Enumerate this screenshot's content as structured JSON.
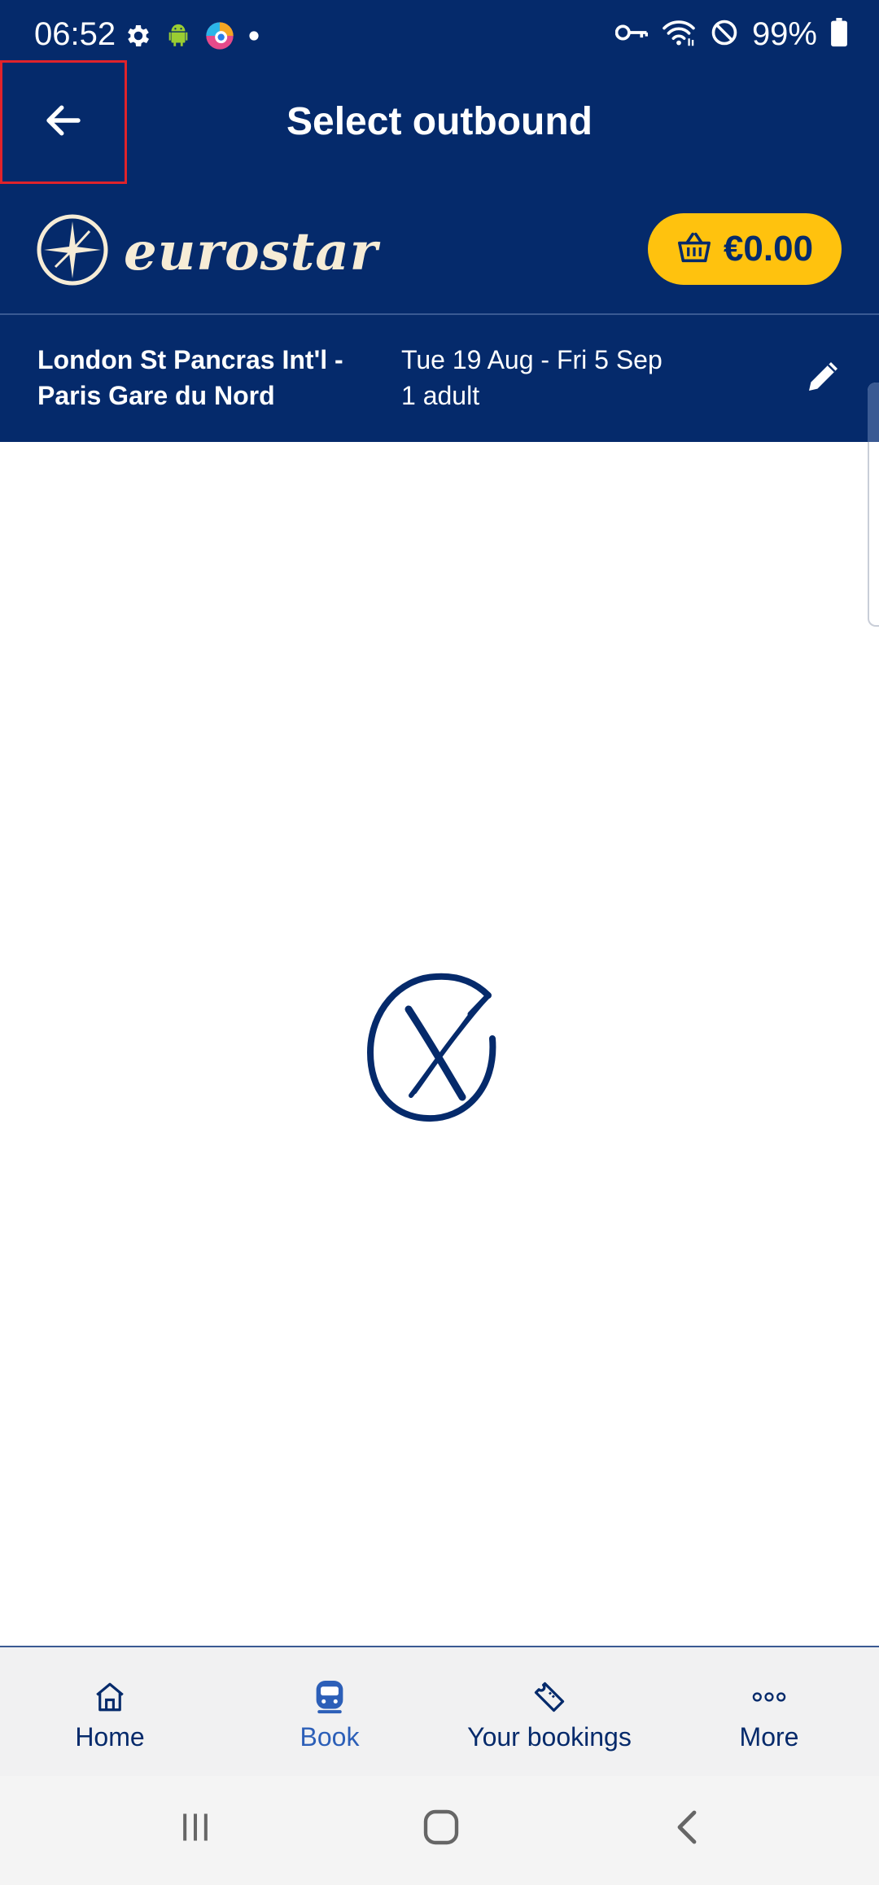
{
  "status_bar": {
    "time": "06:52",
    "battery_percent": "99%",
    "left_icons": [
      "settings-icon",
      "android-icon",
      "browser-icon",
      "dot-icon"
    ],
    "right_icons": [
      "key-icon",
      "wifi-icon",
      "do-not-disturb-icon",
      "battery-icon"
    ]
  },
  "app_bar": {
    "title": "Select outbound",
    "back_icon": "arrow-left-icon"
  },
  "brand": {
    "logo_text": "eurostar",
    "basket_price": "€0.00",
    "basket_icon": "basket-icon"
  },
  "journey": {
    "route_line1": "London St Pancras Int'l -",
    "route_line2": "Paris Gare du Nord",
    "dates": "Tue 19 Aug - Fri 5 Sep",
    "passengers": "1 adult",
    "edit_icon": "pencil-icon"
  },
  "loading": {
    "icon": "eurostar-loading-icon"
  },
  "bottom_nav": {
    "items": [
      {
        "label": "Home",
        "icon": "home-icon",
        "active": false
      },
      {
        "label": "Book",
        "icon": "train-icon",
        "active": true
      },
      {
        "label": "Your bookings",
        "icon": "ticket-icon",
        "active": false
      },
      {
        "label": "More",
        "icon": "more-dots-icon",
        "active": false
      }
    ]
  },
  "system_nav": {
    "items": [
      "recents-icon",
      "home-circle-icon",
      "back-chevron-icon"
    ]
  },
  "colors": {
    "brand_navy": "#052a6b",
    "basket_yellow": "#ffc20e",
    "logo_cream": "#f6ecd6",
    "active_nav": "#2c5fb8",
    "highlight_red": "#e0232b"
  }
}
